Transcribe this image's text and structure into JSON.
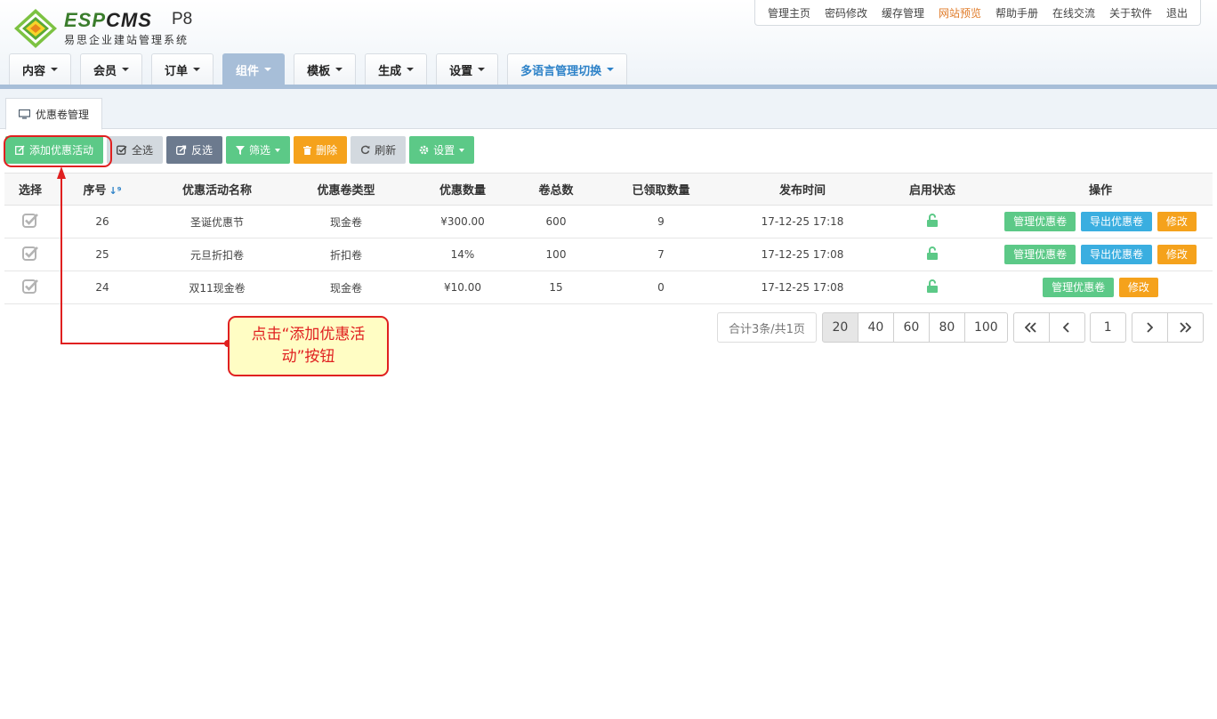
{
  "app": {
    "logo_esp": "ESP",
    "logo_cms": "CMS",
    "version": "P8",
    "subtitle": "易思企业建站管理系统"
  },
  "top_links": [
    "管理主页",
    "密码修改",
    "缓存管理",
    "网站预览",
    "帮助手册",
    "在线交流",
    "关于软件",
    "退出"
  ],
  "nav": {
    "tabs": [
      "内容",
      "会员",
      "订单",
      "组件",
      "模板",
      "生成",
      "设置",
      "多语言管理切换"
    ],
    "active": "组件"
  },
  "page_tab": "优惠卷管理",
  "toolbar": {
    "add": "添加优惠活动",
    "select_all": "全选",
    "invert": "反选",
    "filter": "筛选",
    "delete": "删除",
    "refresh": "刷新",
    "settings": "设置"
  },
  "table": {
    "headers": [
      "选择",
      "序号",
      "优惠活动名称",
      "优惠卷类型",
      "优惠数量",
      "卷总数",
      "已领取数量",
      "发布时间",
      "启用状态",
      "操作"
    ],
    "rows": [
      {
        "id": "26",
        "name": "圣诞优惠节",
        "type": "现金卷",
        "amount": "¥300.00",
        "total": "600",
        "claimed": "9",
        "time": "17-12-25 17:18"
      },
      {
        "id": "25",
        "name": "元旦折扣卷",
        "type": "折扣卷",
        "amount": "14%",
        "total": "100",
        "claimed": "7",
        "time": "17-12-25 17:08"
      },
      {
        "id": "24",
        "name": "双11现金卷",
        "type": "现金卷",
        "amount": "¥10.00",
        "total": "15",
        "claimed": "0",
        "time": "17-12-25 17:08"
      }
    ],
    "actions": {
      "manage": "管理优惠卷",
      "export": "导出优惠卷",
      "edit": "修改"
    }
  },
  "pager": {
    "info": "合计3条/共1页",
    "sizes": [
      "20",
      "40",
      "60",
      "80",
      "100"
    ],
    "current_page": "1"
  },
  "annotation": {
    "text": "点击“添加优惠活动”按钮"
  },
  "colors": {
    "accent_blue": "#a7bed8",
    "green": "#5cc987",
    "orange": "#f5a21c",
    "callout_red": "#e02020"
  }
}
